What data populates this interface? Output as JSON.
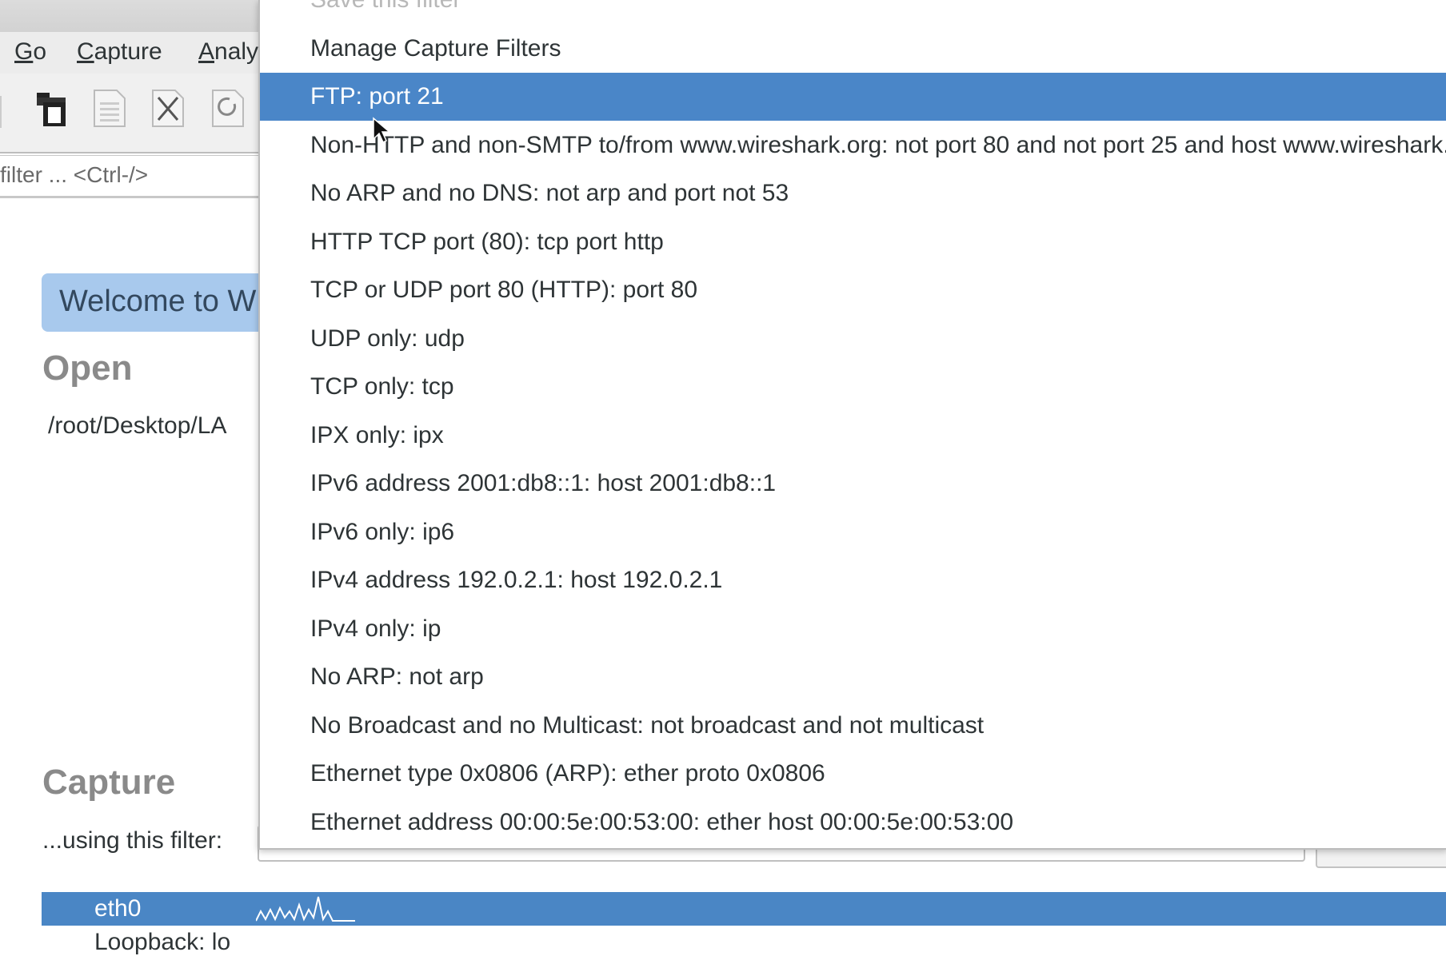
{
  "menubar": {
    "items": [
      {
        "label": "Go",
        "mnemonic": "G"
      },
      {
        "label": "Capture",
        "mnemonic": "C"
      },
      {
        "label": "Analy",
        "mnemonic": "A"
      }
    ]
  },
  "toolbar": {
    "icons": [
      "open-file-icon",
      "save-file-icon",
      "close-file-icon",
      "reload-file-icon"
    ]
  },
  "display_filter": {
    "placeholder": "filter ... <Ctrl-/>"
  },
  "welcome": {
    "banner": "Welcome to W",
    "open_heading": "Open",
    "recent_file": "/root/Desktop/LA",
    "capture_heading": "Capture",
    "using_filter_label": "...using this filter:",
    "interfaces": [
      {
        "name": "eth0",
        "selected": true
      },
      {
        "name": "Loopback: lo",
        "selected": false
      }
    ]
  },
  "colors": {
    "accent": "#4a86c8",
    "banner": "#a8c9ed"
  },
  "capture_filter_menu": {
    "items": [
      {
        "label": "Save this filter",
        "disabled": true
      },
      {
        "label": "Manage Capture Filters"
      },
      {
        "label": "FTP: port 21",
        "selected": true
      },
      {
        "label": "Non-HTTP and non-SMTP to/from www.wireshark.org: not port 80 and not port 25 and host www.wireshark.org"
      },
      {
        "label": "No ARP and no DNS: not arp and port not 53"
      },
      {
        "label": "HTTP TCP port (80): tcp port http"
      },
      {
        "label": "TCP or UDP port 80 (HTTP): port 80"
      },
      {
        "label": "UDP only: udp"
      },
      {
        "label": "TCP only: tcp"
      },
      {
        "label": "IPX only: ipx"
      },
      {
        "label": "IPv6 address 2001:db8::1: host 2001:db8::1"
      },
      {
        "label": "IPv6 only: ip6"
      },
      {
        "label": "IPv4 address 192.0.2.1: host 192.0.2.1"
      },
      {
        "label": "IPv4 only: ip"
      },
      {
        "label": "No ARP: not arp"
      },
      {
        "label": "No Broadcast and no Multicast: not broadcast and not multicast"
      },
      {
        "label": "Ethernet type 0x0806 (ARP): ether proto 0x0806"
      },
      {
        "label": "Ethernet address 00:00:5e:00:53:00: ether host 00:00:5e:00:53:00"
      }
    ]
  }
}
